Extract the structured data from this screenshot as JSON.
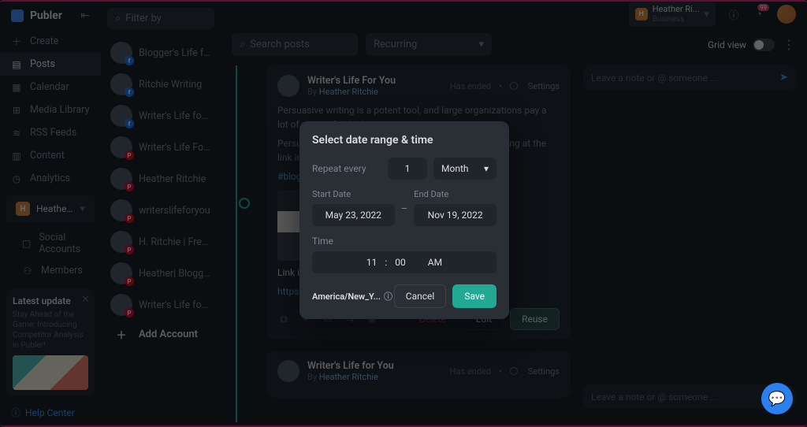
{
  "brand": {
    "name": "Publer"
  },
  "nav": {
    "items": [
      {
        "icon": "＋",
        "label": "Create"
      },
      {
        "icon": "▤",
        "label": "Posts",
        "active": true
      },
      {
        "icon": "▦",
        "label": "Calendar"
      },
      {
        "icon": "⊞",
        "label": "Media Library"
      },
      {
        "icon": "≋",
        "label": "RSS Feeds"
      },
      {
        "icon": "▥",
        "label": "Content"
      },
      {
        "icon": "◷",
        "label": "Analytics"
      }
    ]
  },
  "workspace": {
    "badge": "H",
    "name": "Heather Ritchi...",
    "plan": "Business",
    "sub": [
      {
        "icon": "▢",
        "label": "Social Accounts"
      },
      {
        "icon": "⚇",
        "label": "Members"
      }
    ]
  },
  "update_card": {
    "title": "Latest update",
    "text": "Stay Ahead of the Game: Introducing Competitor Analysis in Publer!"
  },
  "help_label": "Help Center",
  "accounts": {
    "filter_placeholder": "Filter by",
    "list": [
      {
        "name": "Blogger's Life for ...",
        "net": "fb"
      },
      {
        "name": "Ritchie Writing",
        "net": "fb"
      },
      {
        "name": "Writer's Life for You",
        "net": "fb"
      },
      {
        "name": "Writer's Life For You",
        "net": "pin"
      },
      {
        "name": "Heather Ritchie",
        "net": "pin"
      },
      {
        "name": "writerslifeforyou",
        "net": "pin"
      },
      {
        "name": "H. Ritchie | Freela...",
        "net": "pin"
      },
      {
        "name": "Heather| Blogger'...",
        "net": "pin"
      },
      {
        "name": "Writer's Life for Yo...",
        "net": "pin"
      }
    ],
    "add_label": "Add Account"
  },
  "topbar": {
    "ws_name": "Heather Ri...",
    "ws_plan": "Business",
    "bell_count": "99"
  },
  "toolbar": {
    "search_placeholder": "Search posts",
    "filter_select": "Recurring",
    "grid_label": "Grid view"
  },
  "posts": [
    {
      "title": "Writer's Life For You",
      "by_label": "By",
      "author": "Heather Ritchie",
      "status": "Has ended",
      "settings": "Settings",
      "body1": "Persuasive writing is a potent tool, and large organizations pay a lot of money for the best writers in t",
      "body2": "Persuasive                                                                                                                         log posts to sales em                                                                                                                         vely. Learn 10  powerf                                                                                                                        ng at the link in the t",
      "hashtags": "#blogging",
      "link_label": "Link in Bio",
      "link_url": "https://write",
      "delete": "Delete",
      "edit": "Edit",
      "reuse": "Reuse"
    },
    {
      "title": "Writer's Life for You",
      "by_label": "By",
      "author": "Heather Ritchie",
      "status": "Has ended",
      "settings": "Settings"
    }
  ],
  "note_placeholder": "Leave a note or @ someone ...",
  "modal": {
    "title": "Select date range & time",
    "repeat_label": "Repeat every",
    "repeat_value": "1",
    "repeat_unit": "Month",
    "start_label": "Start Date",
    "start_value": "May 23, 2022",
    "end_label": "End Date",
    "end_value": "Nov 19, 2022",
    "time_label": "Time",
    "hour": "11",
    "minute": "00",
    "ampm": "AM",
    "timezone": "America/New_Y...",
    "cancel": "Cancel",
    "save": "Save"
  }
}
